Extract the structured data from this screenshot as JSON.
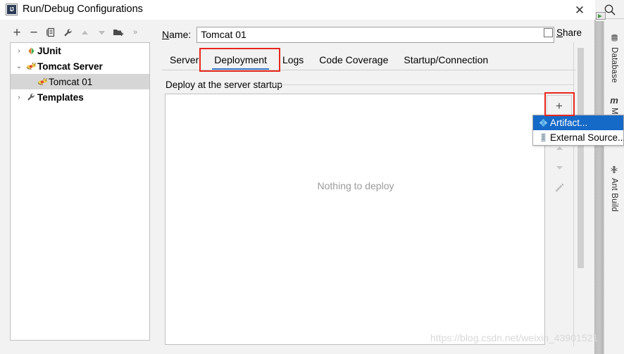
{
  "window": {
    "title": "Run/Debug Configurations",
    "app_icon": "intellij-idea-icon",
    "close_label": "✕"
  },
  "toolbar": {
    "buttons": [
      {
        "name": "add-configuration-button",
        "glyph": "+",
        "enabled": true
      },
      {
        "name": "remove-configuration-button",
        "glyph": "−",
        "enabled": true
      },
      {
        "name": "copy-configuration-button",
        "glyph": "copy-icon",
        "enabled": true
      },
      {
        "name": "edit-templates-button",
        "glyph": "wrench-icon",
        "enabled": true
      },
      {
        "name": "move-up-button",
        "glyph": "▲",
        "enabled": false
      },
      {
        "name": "move-down-button",
        "glyph": "▼",
        "enabled": false
      },
      {
        "name": "create-folder-button",
        "glyph": "folder-plus-icon",
        "enabled": true
      },
      {
        "name": "more-options-button",
        "glyph": "»",
        "enabled": true
      }
    ]
  },
  "tree": {
    "items": [
      {
        "label": "JUnit",
        "arrow": "›",
        "icon": "junit-icon",
        "bold": true,
        "indent": false,
        "selected": false
      },
      {
        "label": "Tomcat Server",
        "arrow": "⌄",
        "icon": "tomcat-icon",
        "bold": true,
        "indent": false,
        "selected": false
      },
      {
        "label": "Tomcat 01",
        "arrow": "",
        "icon": "tomcat-icon",
        "bold": false,
        "indent": true,
        "selected": true
      },
      {
        "label": "Templates",
        "arrow": "›",
        "icon": "wrench-icon",
        "bold": true,
        "indent": false,
        "selected": false
      }
    ]
  },
  "name_field": {
    "label_prefix": "",
    "label_underlined": "N",
    "label_suffix": "ame:",
    "value": "Tomcat 01",
    "placeholder": ""
  },
  "share": {
    "checked": false,
    "label_underlined": "S",
    "label_suffix": "hare"
  },
  "tabs": [
    {
      "label": "Server",
      "selected": false
    },
    {
      "label": "Deployment",
      "selected": true
    },
    {
      "label": "Logs",
      "selected": false
    },
    {
      "label": "Code Coverage",
      "selected": false
    },
    {
      "label": "Startup/Connection",
      "selected": false
    }
  ],
  "deployment": {
    "group_caption": "Deploy at the server startup",
    "empty_text": "Nothing to deploy",
    "side_actions": [
      {
        "name": "add-artifact-button",
        "glyph": "+",
        "enabled": true
      },
      {
        "name": "remove-artifact-button",
        "glyph": "−",
        "enabled": false
      },
      {
        "name": "move-up-artifact-button",
        "glyph": "▲",
        "enabled": false
      },
      {
        "name": "move-down-artifact-button",
        "glyph": "▼",
        "enabled": false
      },
      {
        "name": "edit-artifact-button",
        "glyph": "pencil-icon",
        "enabled": false
      }
    ]
  },
  "popup_menu": {
    "items": [
      {
        "label": "Artifact...",
        "icon": "artifact-diamond-icon",
        "highlighted": true
      },
      {
        "label": "External Source...",
        "icon": "external-source-icon",
        "highlighted": false
      }
    ]
  },
  "annotations": {
    "accent_color": "#e8281e",
    "targets": [
      "deployment-tab",
      "add-artifact-button"
    ]
  },
  "ide_sidebar": {
    "search_icon": "search-icon",
    "tools": [
      {
        "label": "Database",
        "icon": "database-icon"
      },
      {
        "label": "M",
        "icon": "maven-icon"
      },
      {
        "label": "Ant Build",
        "icon": "ant-icon"
      }
    ]
  },
  "watermark": {
    "text": "https://blog.csdn.net/weixin_43901521"
  },
  "colors": {
    "tab_selected_underline": "#3d7cc9",
    "menu_highlight": "#1569c7",
    "annotation_red": "#e8281e",
    "dialog_bg": "#f2f2f2"
  }
}
